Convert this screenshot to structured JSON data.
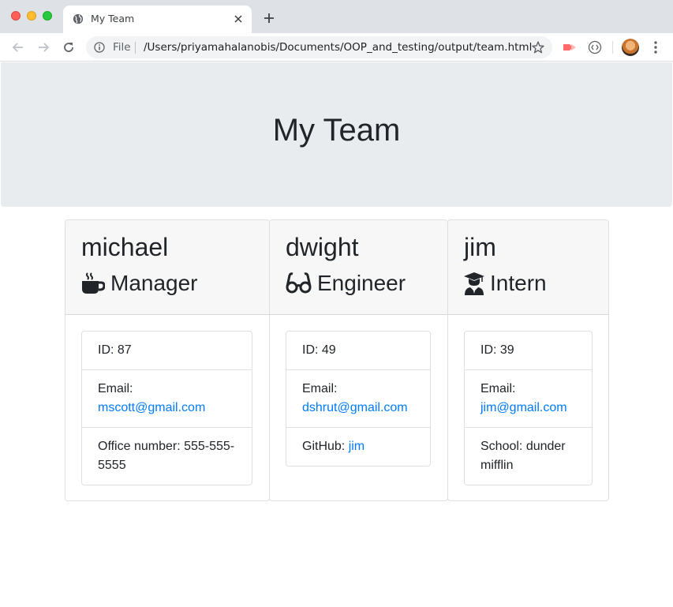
{
  "browser": {
    "tab_title": "My Team",
    "file_label": "File",
    "url": "/Users/priyamahalanobis/Documents/OOP_and_testing/output/team.html"
  },
  "page": {
    "title": "My Team"
  },
  "employees": [
    {
      "name": "michael",
      "role": "Manager",
      "role_icon": "coffee-mug-icon",
      "id_text": "ID: 87",
      "email_label": "Email:",
      "email": "mscott@gmail.com",
      "extra_label": "Office number: ",
      "extra_value": "555-555-5555",
      "extra_line": "Office number: 555-555-5555"
    },
    {
      "name": "dwight",
      "role": "Engineer",
      "role_icon": "glasses-icon",
      "id_text": "ID: 49",
      "email_label": "Email:",
      "email": "dshrut@gmail.com",
      "extra_label": "GitHub: ",
      "extra_value": "jim"
    },
    {
      "name": "jim",
      "role": "Intern",
      "role_icon": "graduate-icon",
      "id_text": "ID: 39",
      "email_label": "Email:",
      "email": "jim@gmail.com",
      "extra_label": "School: ",
      "extra_value": "dunder mifflin",
      "extra_line": "School: dunder mifflin"
    }
  ],
  "colors": {
    "link": "#007bff",
    "jumbotron_bg": "#e9ecef",
    "card_header_bg": "#f7f7f7"
  }
}
